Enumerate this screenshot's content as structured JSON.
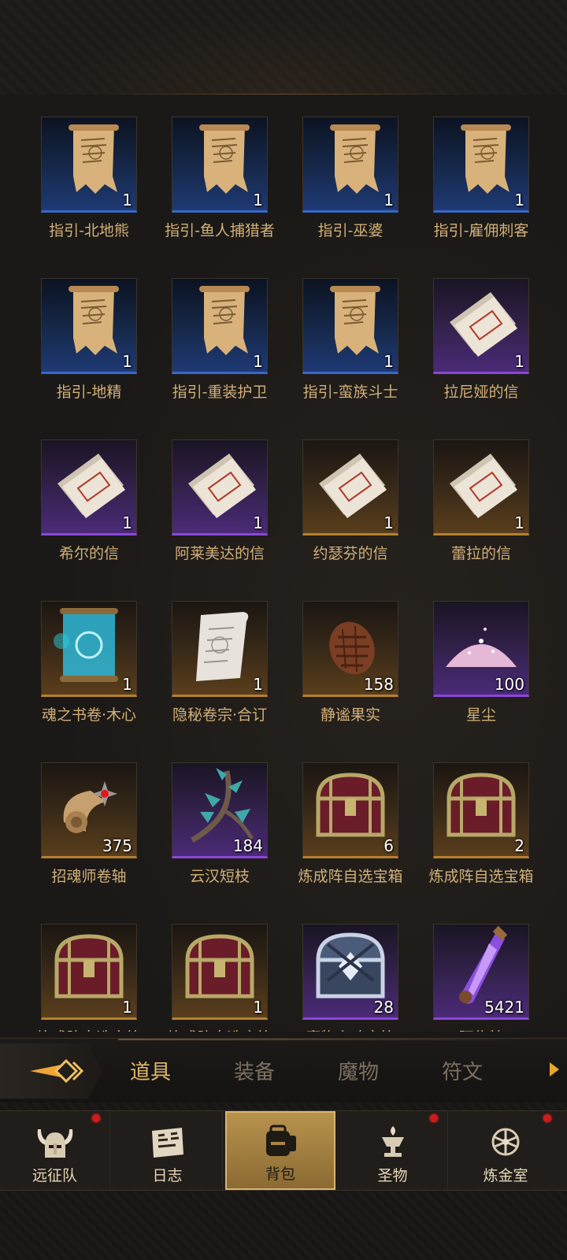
{
  "rows": [
    [
      {
        "name": "指引-北地熊",
        "qty": "1",
        "rarity": "blue",
        "icon": "scroll-map-icon"
      },
      {
        "name": "指引-鱼人捕猎者",
        "qty": "1",
        "rarity": "blue",
        "icon": "scroll-map-icon"
      },
      {
        "name": "指引-巫婆",
        "qty": "1",
        "rarity": "blue",
        "icon": "scroll-map-icon"
      },
      {
        "name": "指引-雇佣刺客",
        "qty": "1",
        "rarity": "blue",
        "icon": "scroll-map-icon"
      }
    ],
    [
      {
        "name": "指引-地精",
        "qty": "1",
        "rarity": "blue",
        "icon": "scroll-map-icon"
      },
      {
        "name": "指引-重装护卫",
        "qty": "1",
        "rarity": "blue",
        "icon": "scroll-map-icon"
      },
      {
        "name": "指引-蛮族斗士",
        "qty": "1",
        "rarity": "blue",
        "icon": "scroll-map-icon"
      },
      {
        "name": "拉尼娅的信",
        "qty": "1",
        "rarity": "purple",
        "icon": "letter-icon"
      }
    ],
    [
      {
        "name": "希尔的信",
        "qty": "1",
        "rarity": "purple",
        "icon": "letter-icon"
      },
      {
        "name": "阿莱美达的信",
        "qty": "1",
        "rarity": "purple",
        "icon": "letter-icon"
      },
      {
        "name": "约瑟芬的信",
        "qty": "1",
        "rarity": "gold",
        "icon": "letter-icon"
      },
      {
        "name": "蕾拉的信",
        "qty": "1",
        "rarity": "gold",
        "icon": "letter-icon"
      }
    ],
    [
      {
        "name": "魂之书卷·木心",
        "qty": "1",
        "rarity": "gold",
        "icon": "soul-scroll-icon"
      },
      {
        "name": "隐秘卷宗·合订",
        "qty": "1",
        "rarity": "gold",
        "icon": "secret-scroll-icon"
      },
      {
        "name": "静谧果实",
        "qty": "158",
        "rarity": "gold",
        "icon": "pinecone-fruit-icon"
      },
      {
        "name": "星尘",
        "qty": "100",
        "rarity": "purple",
        "icon": "stardust-icon"
      }
    ],
    [
      {
        "name": "招魂师卷轴",
        "qty": "375",
        "rarity": "gold",
        "icon": "summoner-scroll-icon"
      },
      {
        "name": "云汉短枝",
        "qty": "184",
        "rarity": "purple",
        "icon": "branch-icon"
      },
      {
        "name": "炼成阵自选宝箱",
        "qty": "6",
        "rarity": "gold",
        "icon": "treasure-chest-icon"
      },
      {
        "name": "炼成阵自选宝箱",
        "qty": "2",
        "rarity": "gold",
        "icon": "treasure-chest-icon"
      }
    ],
    [
      {
        "name": "炼成阵自选宝箱",
        "qty": "1",
        "rarity": "gold",
        "icon": "treasure-chest-icon"
      },
      {
        "name": "炼成阵自选宝箱",
        "qty": "1",
        "rarity": "gold",
        "icon": "treasure-chest-icon"
      },
      {
        "name": "魔物之魂宝箱",
        "qty": "28",
        "rarity": "purple",
        "icon": "monster-soul-chest-icon"
      },
      {
        "name": "阿佐特",
        "qty": "5421",
        "rarity": "purple",
        "icon": "crystal-vial-icon"
      }
    ]
  ],
  "tabs": [
    {
      "label": "道具",
      "active": true
    },
    {
      "label": "装备",
      "active": false
    },
    {
      "label": "魔物",
      "active": false
    },
    {
      "label": "符文",
      "active": false
    }
  ],
  "nav": [
    {
      "label": "远征队",
      "icon": "viking-helmet-icon",
      "dot": true,
      "active": false
    },
    {
      "label": "日志",
      "icon": "journal-icon",
      "dot": false,
      "active": false
    },
    {
      "label": "背包",
      "icon": "backpack-icon",
      "dot": false,
      "active": true
    },
    {
      "label": "圣物",
      "icon": "relic-chalice-icon",
      "dot": true,
      "active": false
    },
    {
      "label": "炼金室",
      "icon": "alchemy-icon",
      "dot": true,
      "active": false
    }
  ],
  "colors": {
    "accent": "#e0b866",
    "rarity_blue": "#3a67c8",
    "rarity_purple": "#8b46d8",
    "rarity_gold": "#b6802f",
    "notify_dot": "#d21a1a"
  }
}
